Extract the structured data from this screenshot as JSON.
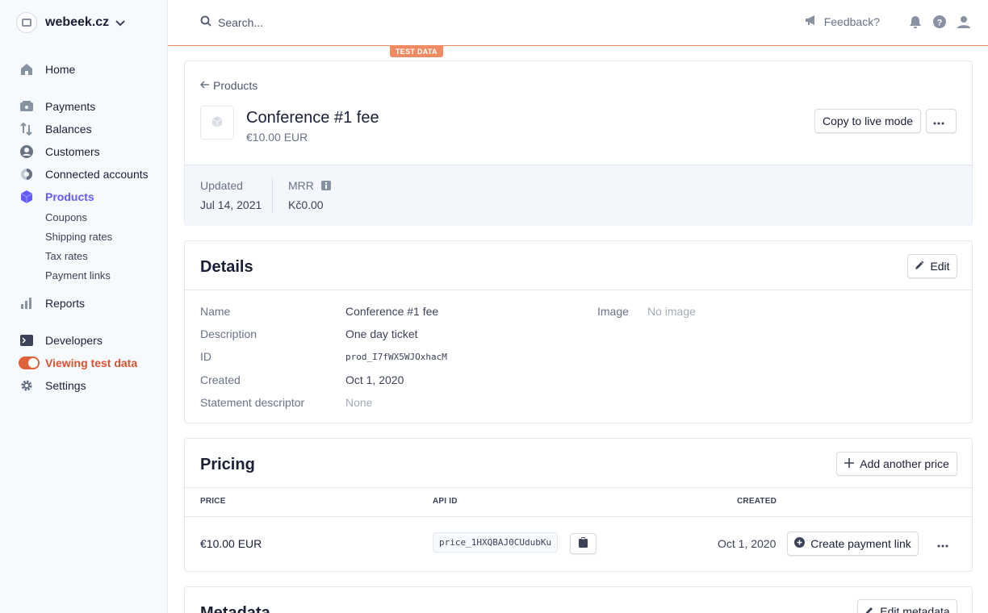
{
  "account": {
    "name": "webeek.cz"
  },
  "nav": {
    "home": "Home",
    "payments": "Payments",
    "balances": "Balances",
    "customers": "Customers",
    "connected": "Connected accounts",
    "products": "Products",
    "coupons": "Coupons",
    "shipping": "Shipping rates",
    "tax": "Tax rates",
    "payment_links": "Payment links",
    "reports": "Reports",
    "developers": "Developers",
    "test_data": "Viewing test data",
    "settings": "Settings"
  },
  "topbar": {
    "search_placeholder": "Search...",
    "feedback": "Feedback?",
    "badge": "TEST DATA"
  },
  "product": {
    "back_label": "Products",
    "title": "Conference #1 fee",
    "subtitle": "€10.00 EUR",
    "copy_live": "Copy to live mode",
    "updated_label": "Updated",
    "updated_value": "Jul 14, 2021",
    "mrr_label": "MRR",
    "mrr_value": "Kč0.00"
  },
  "details": {
    "title": "Details",
    "edit": "Edit",
    "name_label": "Name",
    "name_value": "Conference #1 fee",
    "desc_label": "Description",
    "desc_value": "One day ticket",
    "id_label": "ID",
    "id_value": "prod_I7fWX5WJOxhacM",
    "created_label": "Created",
    "created_value": "Oct 1, 2020",
    "stmt_label": "Statement descriptor",
    "stmt_value": "None",
    "image_label": "Image",
    "image_value": "No image"
  },
  "pricing": {
    "title": "Pricing",
    "add_price": "Add another price",
    "headers": {
      "price": "PRICE",
      "api_id": "API ID",
      "created": "CREATED"
    },
    "row": {
      "price": "€10.00 EUR",
      "api_id": "price_1HXQBAJ0CUdubKu",
      "created": "Oct 1, 2020",
      "create_link": "Create payment link"
    }
  },
  "metadata": {
    "title": "Metadata",
    "edit": "Edit metadata"
  },
  "colors": {
    "accent": "#635bff",
    "test": "#ef8b63"
  }
}
